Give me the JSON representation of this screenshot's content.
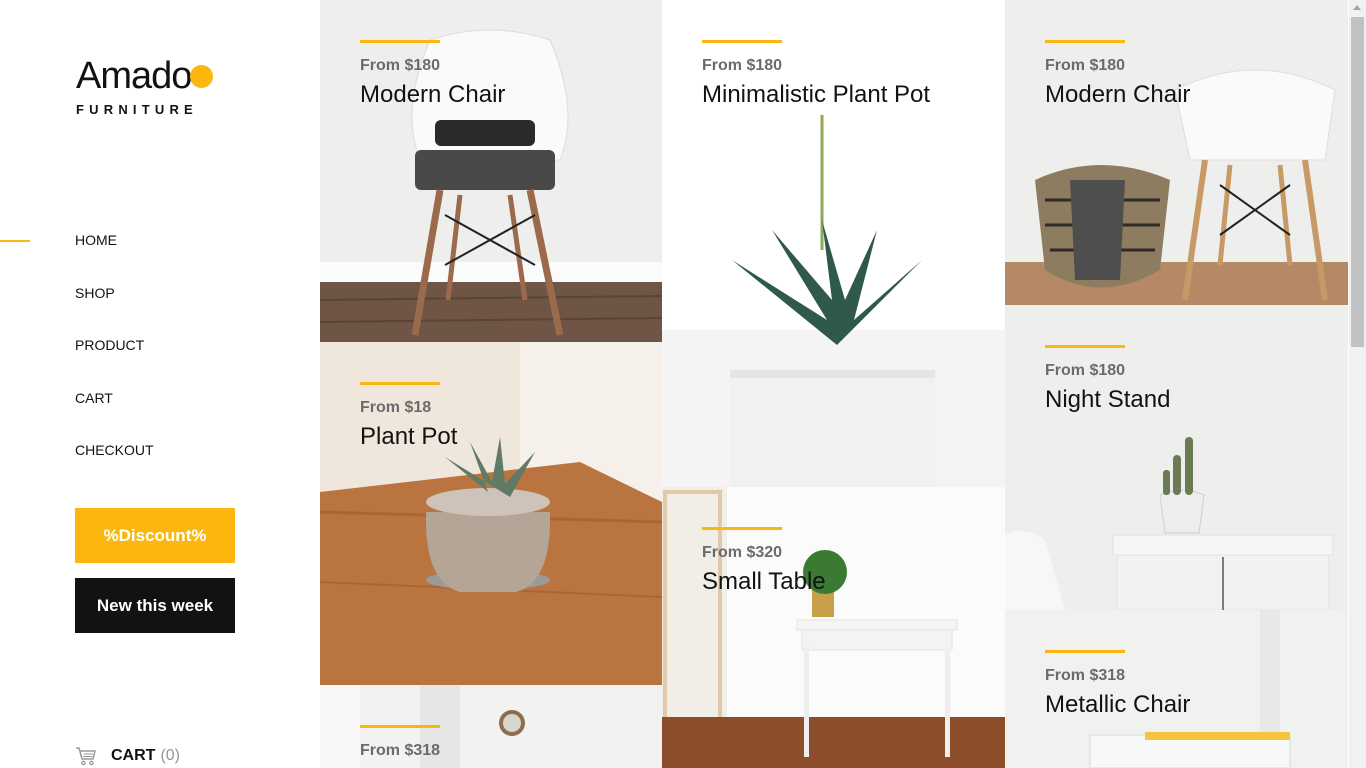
{
  "brand": {
    "name": "Amado",
    "tagline": "FURNITURE",
    "accent_color": "#fbb710",
    "dark_color": "#131212"
  },
  "nav": {
    "active": "HOME",
    "items": [
      "HOME",
      "SHOP",
      "PRODUCT",
      "CART",
      "CHECKOUT"
    ]
  },
  "buttons": {
    "discount": "%Discount%",
    "new_week": "New this week"
  },
  "cart": {
    "label": "CART",
    "count": "(0)",
    "icon": "cart-icon"
  },
  "products": [
    {
      "price": "From $180",
      "name": "Modern Chair"
    },
    {
      "price": "From $18",
      "name": "Plant Pot"
    },
    {
      "price": "From $318",
      "name": ""
    },
    {
      "price": "From $180",
      "name": "Minimalistic Plant Pot"
    },
    {
      "price": "From $320",
      "name": "Small Table"
    },
    {
      "price": "From $180",
      "name": "Modern Chair"
    },
    {
      "price": "From $180",
      "name": "Night Stand"
    },
    {
      "price": "From $318",
      "name": "Metallic Chair"
    }
  ]
}
